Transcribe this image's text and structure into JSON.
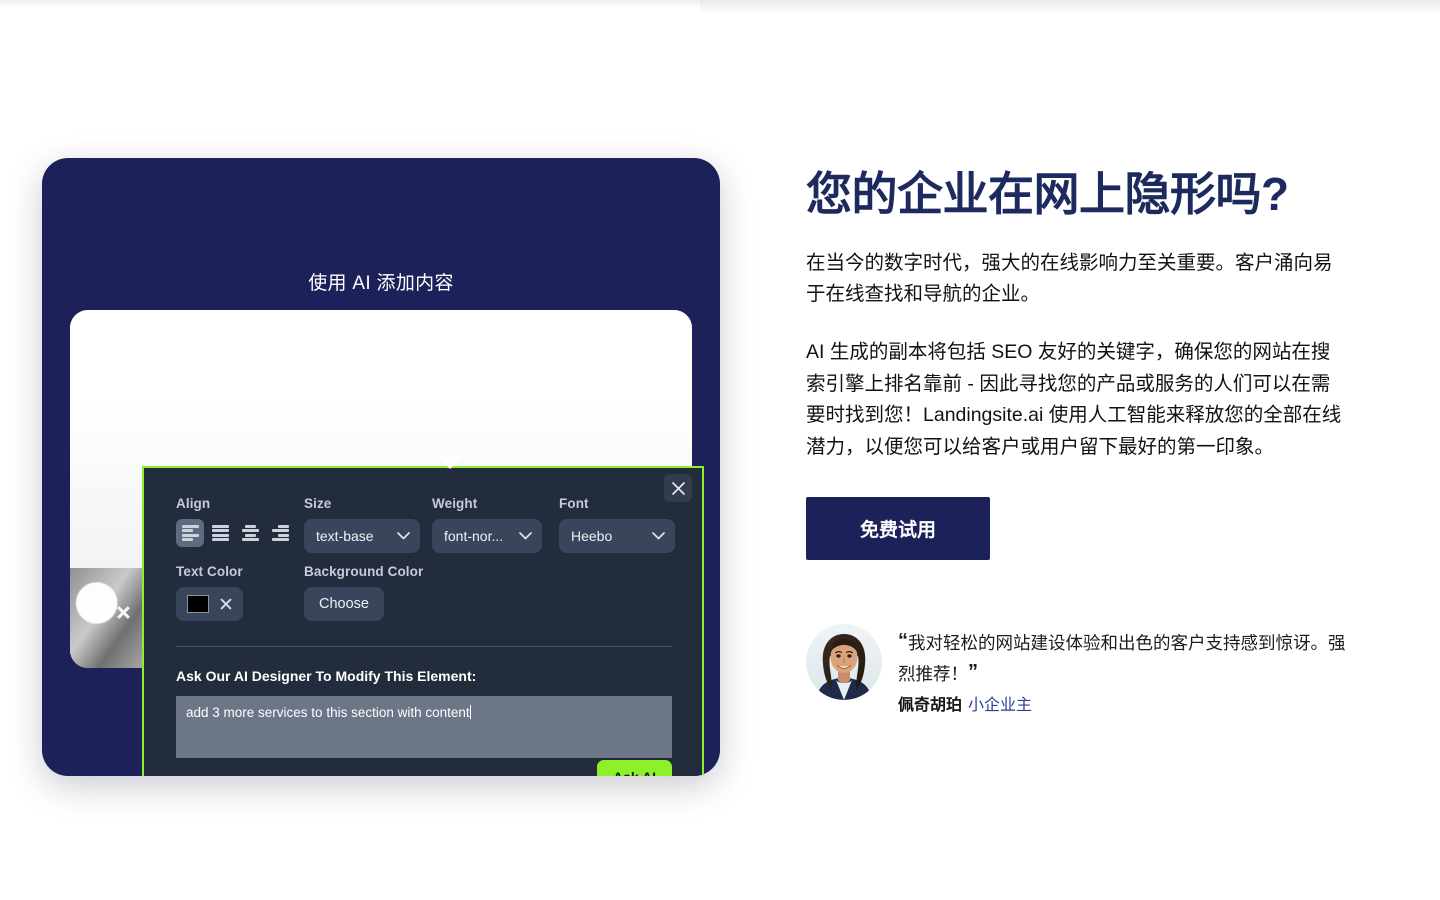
{
  "preview_card": {
    "title": "使用 AI 添加内容"
  },
  "editor": {
    "close_icon": "close-icon",
    "align": {
      "label": "Align",
      "options": [
        "align-left",
        "align-justify",
        "align-center",
        "align-right"
      ],
      "selected": "align-left"
    },
    "size": {
      "label": "Size",
      "value": "text-base"
    },
    "weight": {
      "label": "Weight",
      "value": "font-nor..."
    },
    "font": {
      "label": "Font",
      "value": "Heebo"
    },
    "text_color": {
      "label": "Text Color",
      "value": "#000000",
      "clear_icon": "close-icon"
    },
    "background_color": {
      "label": "Background Color",
      "button": "Choose"
    },
    "ask": {
      "label": "Ask Our AI Designer To Modify This Element:",
      "prompt_value": "add 3 more services to this section with content",
      "submit": "Ask AI"
    },
    "accent_border": "#8ef02a",
    "panel_bg": "#232c3c"
  },
  "hero": {
    "headline": "您的企业在网上隐形吗?",
    "paragraph_1": "在当今的数字时代，强大的在线影响力至关重要。客户涌向易于在线查找和导航的企业。",
    "paragraph_2": "AI 生成的副本将包括 SEO 友好的关键字，确保您的网站在搜索引擎上排名靠前 - 因此寻找您的产品或服务的人们可以在需要时找到您！Landingsite.ai 使用人工智能来释放您的全部在线潜力，以便您可以给客户或用户留下最好的第一印象。",
    "cta_label": "免费试用",
    "cta_color": "#1d2159",
    "headline_color": "#1d2a5e"
  },
  "testimonial": {
    "quote": "我对轻松的网站建设体验和出色的客户支持感到惊讶。强烈推荐！",
    "open_quote": "“",
    "close_quote": "”",
    "name": "佩奇胡珀",
    "role": "小企业主",
    "avatar_alt": "avatar"
  }
}
